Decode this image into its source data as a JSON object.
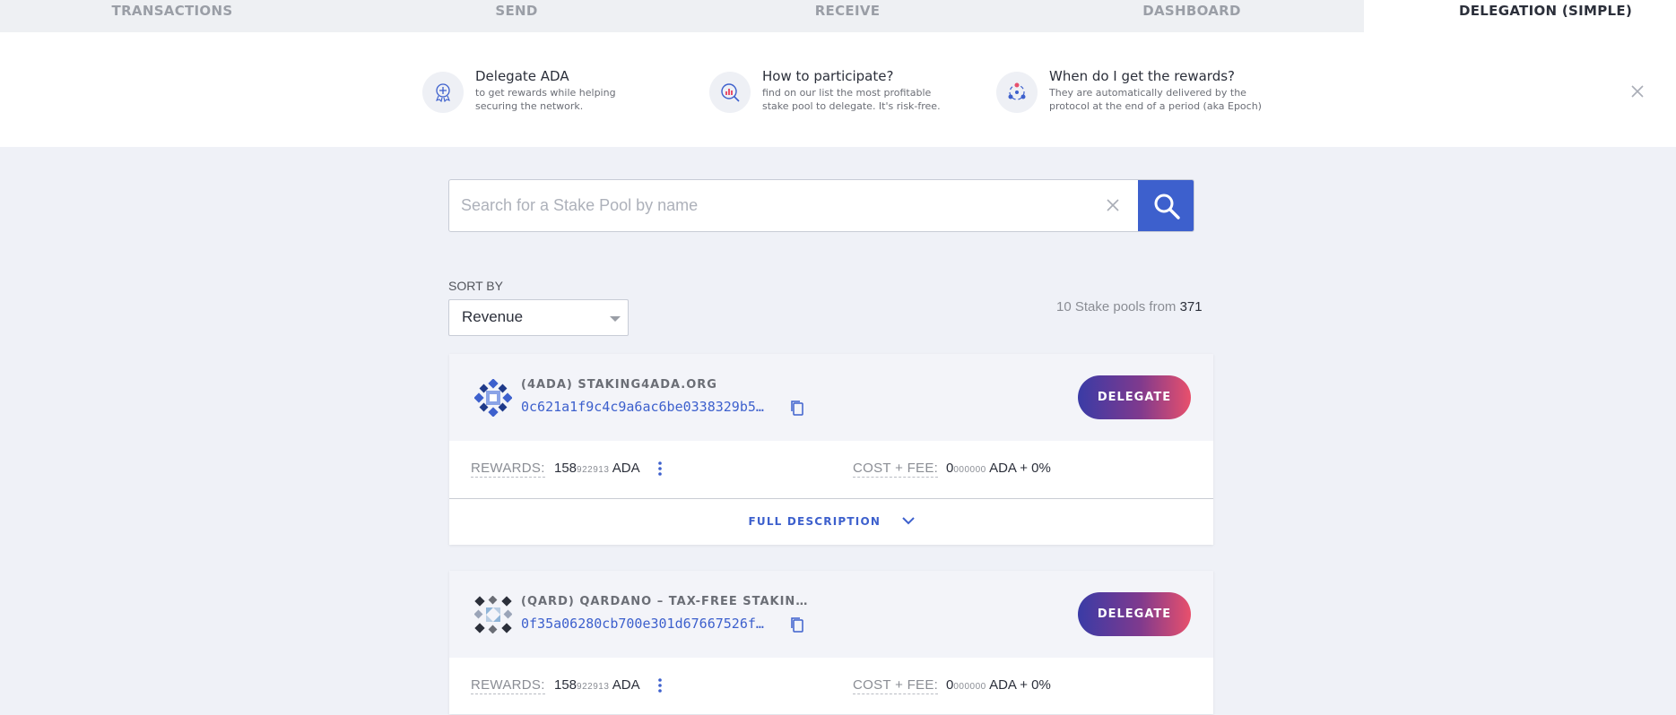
{
  "tabs": [
    {
      "label": "TRANSACTIONS",
      "active": false
    },
    {
      "label": "SEND",
      "active": false
    },
    {
      "label": "RECEIVE",
      "active": false
    },
    {
      "label": "DASHBOARD",
      "active": false
    },
    {
      "label": "DELEGATION (SIMPLE)",
      "active": true
    }
  ],
  "banner": {
    "items": [
      {
        "title": "Delegate ADA",
        "desc": "to get rewards while helping securing the network.",
        "icon": "delegate-icon"
      },
      {
        "title": "How to participate?",
        "desc": "find on our list the most profitable stake pool to delegate. It's risk-free.",
        "icon": "analytics-search-icon"
      },
      {
        "title": "When do I get the rewards?",
        "desc": "They are automatically delivered by the protocol at the end of a period (aka Epoch)",
        "icon": "network-cycle-icon"
      }
    ]
  },
  "search": {
    "placeholder": "Search for a Stake Pool by name",
    "value": ""
  },
  "sort": {
    "label": "SORT BY",
    "selected": "Revenue"
  },
  "pool_count": {
    "prefix": "10 Stake pools from",
    "total": "371"
  },
  "pools": [
    {
      "name": "(4ADA) STAKING4ADA.ORG",
      "id": "0c621a1f9c4c9a6ac6be0338329b5…",
      "delegate_label": "DELEGATE",
      "rewards_label": "REWARDS:",
      "rewards_int": "158",
      "rewards_dec": "922913",
      "rewards_unit": "ADA",
      "cost_label": "COST + FEE:",
      "cost_int": "0",
      "cost_dec": "000000",
      "cost_rest": "ADA + 0%",
      "full_desc_label": "FULL DESCRIPTION"
    },
    {
      "name": "(QARD) QARDANO – TAX-FREE STAKING P…",
      "id": "0f35a06280cb700e301d67667526f…",
      "delegate_label": "DELEGATE",
      "rewards_label": "REWARDS:",
      "rewards_int": "158",
      "rewards_dec": "922913",
      "rewards_unit": "ADA",
      "cost_label": "COST + FEE:",
      "cost_int": "0",
      "cost_dec": "000000",
      "cost_rest": "ADA + 0%"
    }
  ],
  "colors": {
    "accent": "#3d60cd",
    "delegate_gradient_start": "#3a3ba6",
    "delegate_gradient_end": "#e8506c",
    "page_bg": "#eff1f7"
  }
}
